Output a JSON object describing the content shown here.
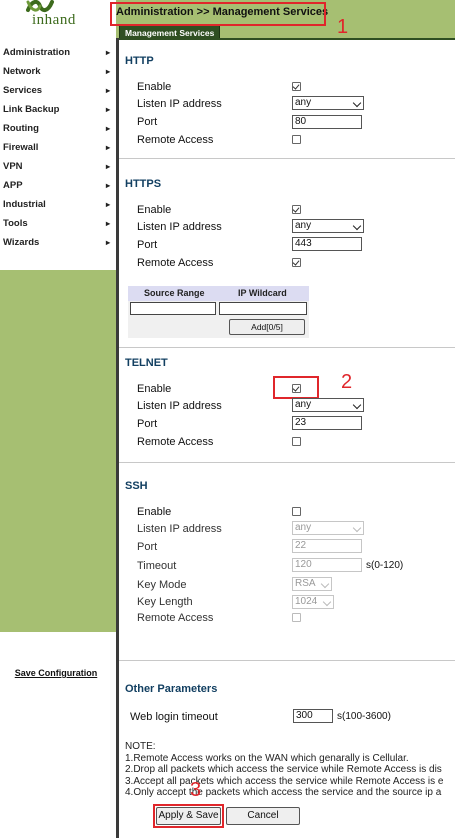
{
  "app": {
    "logo_text": "inhand"
  },
  "sidebar": {
    "items": [
      {
        "label": "Administration",
        "arrow": "▸"
      },
      {
        "label": "Network",
        "arrow": "▸"
      },
      {
        "label": "Services",
        "arrow": "▸"
      },
      {
        "label": "Link Backup",
        "arrow": "▸"
      },
      {
        "label": "Routing",
        "arrow": "▸"
      },
      {
        "label": "Firewall",
        "arrow": "▸"
      },
      {
        "label": "VPN",
        "arrow": "▸"
      },
      {
        "label": "APP",
        "arrow": "▸"
      },
      {
        "label": "Industrial",
        "arrow": "▸"
      },
      {
        "label": "Tools",
        "arrow": "▸"
      },
      {
        "label": "Wizards",
        "arrow": "▸"
      }
    ],
    "save_configuration": "Save Configuration"
  },
  "header": {
    "breadcrumb": "Administration >> Management Services",
    "tab": "Management Services"
  },
  "annotations": {
    "one": "1",
    "two": "2",
    "three": "3"
  },
  "http": {
    "title": "HTTP",
    "enable_label": "Enable",
    "enable_checked": true,
    "listen_label": "Listen IP address",
    "listen_value": "any",
    "port_label": "Port",
    "port_value": "80",
    "remote_label": "Remote Access",
    "remote_checked": false
  },
  "https": {
    "title": "HTTPS",
    "enable_label": "Enable",
    "enable_checked": true,
    "listen_label": "Listen IP address",
    "listen_value": "any",
    "port_label": "Port",
    "port_value": "443",
    "remote_label": "Remote Access",
    "remote_checked": true,
    "table": {
      "col_source": "Source Range",
      "col_wildcard": "IP Wildcard",
      "add_button": "Add[0/5]"
    }
  },
  "telnet": {
    "title": "TELNET",
    "enable_label": "Enable",
    "enable_checked": true,
    "listen_label": "Listen IP address",
    "listen_value": "any",
    "port_label": "Port",
    "port_value": "23",
    "remote_label": "Remote Access",
    "remote_checked": false
  },
  "ssh": {
    "title": "SSH",
    "enable_label": "Enable",
    "enable_checked": false,
    "listen_label": "Listen IP address",
    "listen_value": "any",
    "port_label": "Port",
    "port_value": "22",
    "timeout_label": "Timeout",
    "timeout_value": "120",
    "timeout_suffix": "s(0-120)",
    "keymode_label": "Key Mode",
    "keymode_value": "RSA",
    "keylength_label": "Key Length",
    "keylength_value": "1024",
    "remote_label": "Remote Access",
    "remote_checked": false
  },
  "other": {
    "title": "Other Parameters",
    "web_login_label": "Web login timeout",
    "web_login_value": "300",
    "web_login_suffix": "s(100-3600)"
  },
  "note": {
    "title": "NOTE:",
    "lines": [
      "1.Remote Access works on the WAN which genarally is Cellular.",
      "2.Drop all packets which access the service while Remote Access is dis",
      "3.Accept all packets which access the service while Remote Access is e",
      "4.Only accept the packets which access the service and the source ip a"
    ]
  },
  "buttons": {
    "apply": "Apply & Save",
    "cancel": "Cancel"
  },
  "colors": {
    "accent_green": "#a6bf72",
    "tab_dark_green": "#2f4f22",
    "annotation_red": "#e0262b",
    "section_title": "#123f61"
  }
}
